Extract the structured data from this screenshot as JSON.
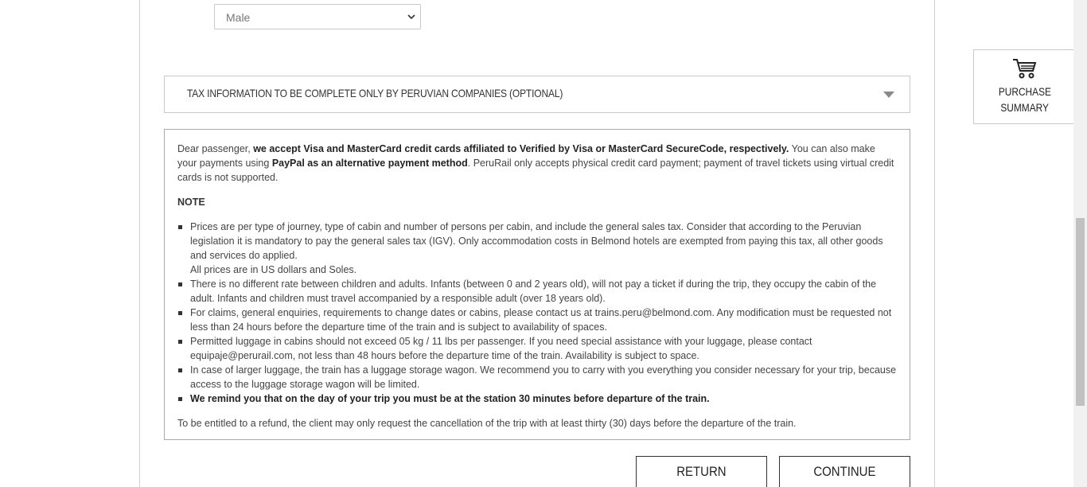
{
  "form": {
    "gender_value": "Male"
  },
  "tax_section": {
    "title": "TAX INFORMATION TO BE COMPLETE ONLY BY PERUVIAN COMPANIES (OPTIONAL)"
  },
  "info": {
    "intro_1": "Dear passenger, ",
    "intro_bold_1": "we accept Visa and MasterCard credit cards affiliated to Verified by Visa or MasterCard SecureCode, respectively.",
    "intro_2": " You can also make your payments using ",
    "intro_bold_2": "PayPal as an alternative payment method",
    "intro_3": ". PeruRail only accepts physical credit card payment; payment of travel tickets using virtual credit cards is not supported.",
    "note_title": "NOTE",
    "notes": [
      "Prices are per type of journey, type of cabin and number of persons per cabin, and include the general sales tax. Consider that according to the Peruvian legislation it is mandatory to pay the general sales tax (IGV). Only accommodation costs in Belmond hotels are exempted from paying this tax, all other goods and services do applied.",
      "All prices are in US dollars and Soles.",
      "There is no different rate between children and adults. Infants (between 0 and 2 years old), will not pay a ticket if during the trip, they occupy the cabin of the adult. Infants and children must travel accompanied by a responsible adult (over 18 years old).",
      "For claims, general enquiries, requirements to change dates or cabins, please contact us at trains.peru@belmond.com. Any modification must be requested not less than 24 hours before the departure time of the train and is subject to availability of spaces.",
      "Permitted luggage in cabins should not exceed 05 kg / 11 lbs per passenger. If you need special assistance with your luggage, please contact equipaje@perurail.com, not less than 48 hours before the departure time of the train. Availability is subject to space.",
      "In case of larger luggage, the train has a luggage storage wagon. We recommend you to carry with you everything you consider necessary for your trip, because access to the luggage storage wagon will be limited.",
      "We remind you that on the day of your trip you must be at the station 30 minutes before departure of the train."
    ],
    "refund": "To be entitled to a refund, the client may only request the cancellation of the trip with at least thirty (30) days before the departure of the train."
  },
  "buttons": {
    "return_label": "RETURN",
    "continue_label": "CONTINUE"
  },
  "summary": {
    "line1": "PURCHASE",
    "line2": "SUMMARY",
    "icon": "shopping-cart-icon"
  },
  "colors": {
    "border": "#c9c9c9",
    "text": "#333333"
  }
}
